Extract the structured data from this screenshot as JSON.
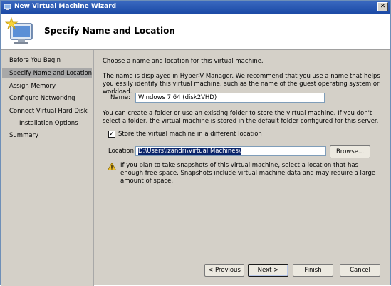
{
  "window": {
    "title": "New Virtual Machine Wizard",
    "close_glyph": "✕"
  },
  "header": {
    "title": "Specify Name and Location",
    "icon": "wizard-monitor-star-icon"
  },
  "nav": {
    "items": [
      {
        "label": "Before You Begin",
        "active": false
      },
      {
        "label": "Specify Name and Location",
        "active": true
      },
      {
        "label": "Assign Memory",
        "active": false
      },
      {
        "label": "Configure Networking",
        "active": false
      },
      {
        "label": "Connect Virtual Hard Disk",
        "active": false
      },
      {
        "label": "Installation Options",
        "active": false,
        "sub": true
      },
      {
        "label": "Summary",
        "active": false
      }
    ]
  },
  "main": {
    "intro": "Choose a name and location for this virtual machine.",
    "name_desc": "The name is displayed in Hyper-V Manager. We recommend that you use a name that helps you easily identify this virtual machine, such as the name of the guest operating system or workload.",
    "name_label": "Name:",
    "name_value": "Windows 7 64 (disk2VHD)",
    "folder_desc": "You can create a folder or use an existing folder to store the virtual machine. If you don't select a folder, the virtual machine is stored in the default folder configured for this server.",
    "store_checkbox_label": "Store the virtual machine in a different location",
    "store_checked": true,
    "location_label": "Location:",
    "location_value": "D:\\Users\\izandri\\Virtual Machines\\",
    "browse_label": "Browse...",
    "warning_text": "If you plan to take snapshots of this virtual machine, select a location that has enough free space. Snapshots include virtual machine data and may require a large amount of space."
  },
  "buttons": {
    "previous": "< Previous",
    "next": "Next >",
    "finish": "Finish",
    "cancel": "Cancel"
  },
  "colors": {
    "title_bar": "#1c4aa6",
    "selection": "#0a246a",
    "warning": "#f2c12e"
  }
}
